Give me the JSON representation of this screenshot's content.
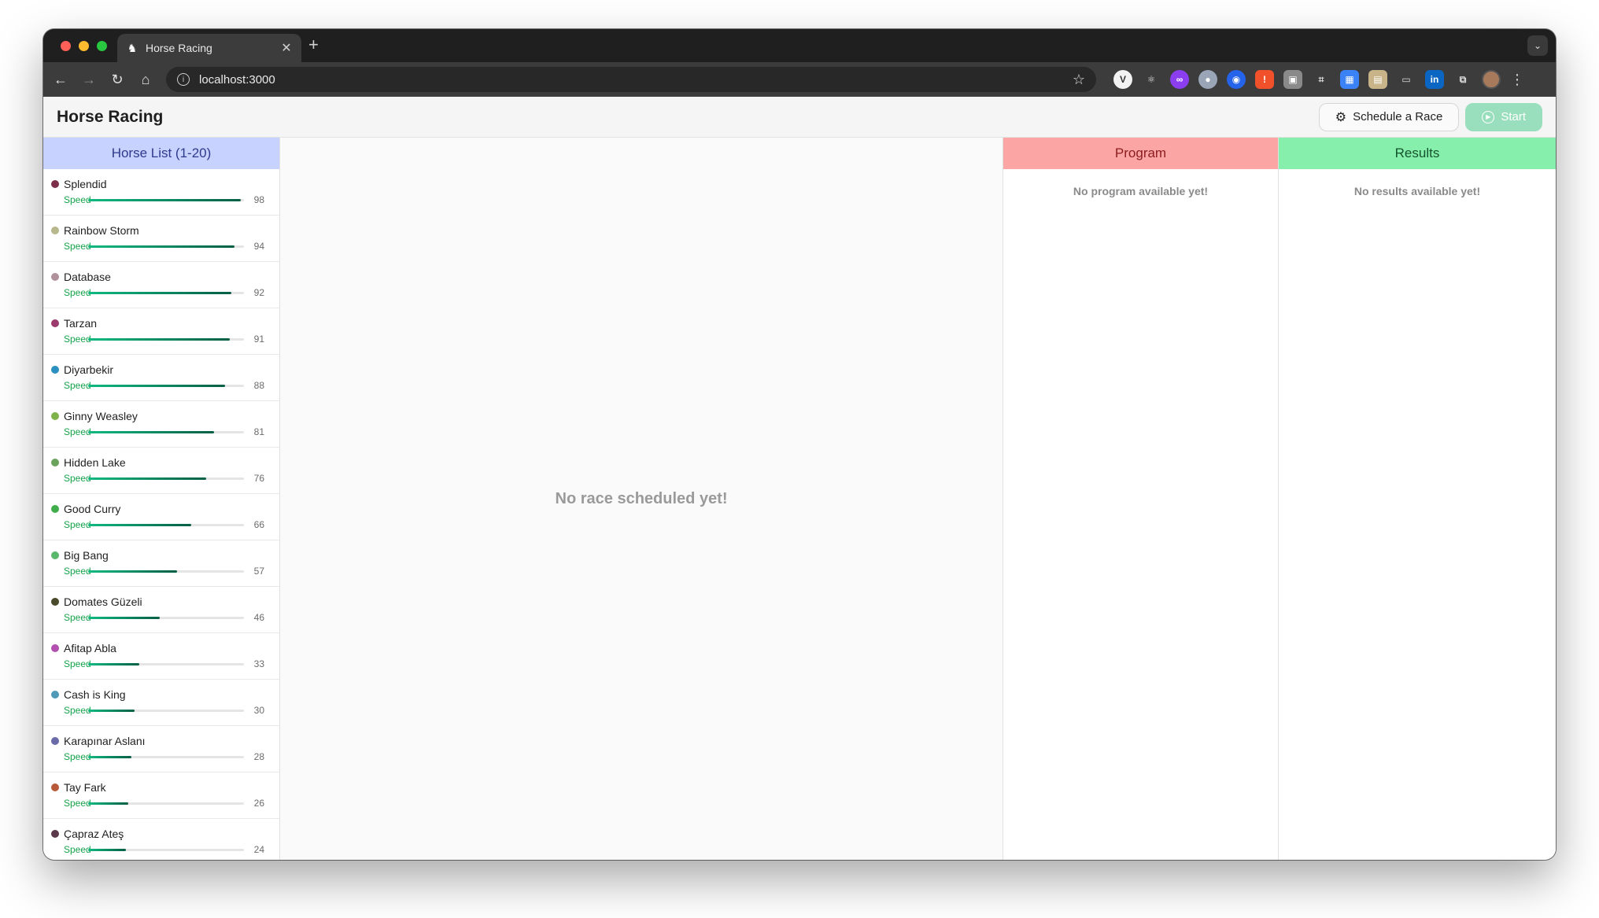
{
  "browser": {
    "tab_title": "Horse Racing",
    "tab_favicon": "horse-icon",
    "url": "localhost:3000"
  },
  "app": {
    "title": "Horse Racing",
    "schedule_label": "Schedule a Race",
    "start_label": "Start"
  },
  "horse_list": {
    "title": "Horse List (1-20)",
    "speed_label": "Speed",
    "horses": [
      {
        "name": "Splendid",
        "color": "#7b2d4a",
        "speed": 98
      },
      {
        "name": "Rainbow Storm",
        "color": "#b8b88c",
        "speed": 94
      },
      {
        "name": "Database",
        "color": "#b0909a",
        "speed": 92
      },
      {
        "name": "Tarzan",
        "color": "#9c3a6e",
        "speed": 91
      },
      {
        "name": "Diyarbekir",
        "color": "#2b8fbf",
        "speed": 88
      },
      {
        "name": "Ginny Weasley",
        "color": "#7fb34a",
        "speed": 81
      },
      {
        "name": "Hidden Lake",
        "color": "#6aa35c",
        "speed": 76
      },
      {
        "name": "Good Curry",
        "color": "#3fae4a",
        "speed": 66
      },
      {
        "name": "Big Bang",
        "color": "#5ab86c",
        "speed": 57
      },
      {
        "name": "Domates Güzeli",
        "color": "#4a4a2a",
        "speed": 46
      },
      {
        "name": "Afitap Abla",
        "color": "#b24fb0",
        "speed": 33
      },
      {
        "name": "Cash is King",
        "color": "#4f9ab8",
        "speed": 30
      },
      {
        "name": "Karapınar Aslanı",
        "color": "#6a6aa8",
        "speed": 28
      },
      {
        "name": "Tay Fark",
        "color": "#b85a3a",
        "speed": 26
      },
      {
        "name": "Çapraz Ateş",
        "color": "#5a3a4a",
        "speed": 24
      }
    ]
  },
  "race": {
    "empty_message": "No race scheduled yet!"
  },
  "program": {
    "title": "Program",
    "empty_message": "No program available yet!"
  },
  "results": {
    "title": "Results",
    "empty_message": "No results available yet!"
  }
}
